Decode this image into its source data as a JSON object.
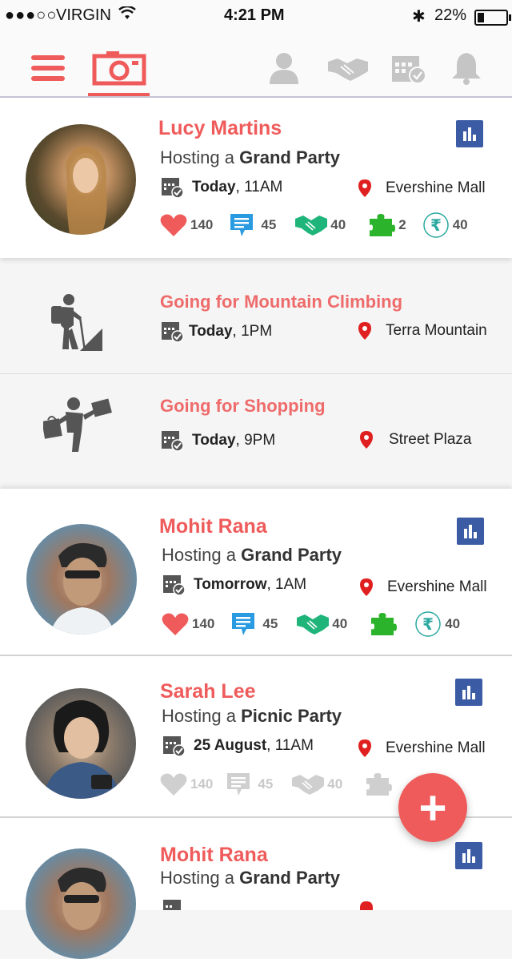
{
  "status_bar": {
    "carrier": "VIRGIN",
    "time": "4:21 PM",
    "battery": "22%"
  },
  "navbar": {
    "items": [
      {
        "name": "menu-icon"
      },
      {
        "name": "camera-icon",
        "active": true
      },
      {
        "name": "profile-icon"
      },
      {
        "name": "handshake-icon"
      },
      {
        "name": "calendar-icon"
      },
      {
        "name": "bell-icon"
      }
    ],
    "accent": "#ef5b5b"
  },
  "feed": [
    {
      "type": "host",
      "name": "Lucy Martins",
      "hosting_prefix": "Hosting a",
      "event": "Grand Party",
      "day": "Today",
      "time": ", 11AM",
      "location": "Evershine Mall",
      "stats": {
        "likes": "140",
        "comments": "45",
        "handshakes": "40",
        "puzzles": "2",
        "rupees": "40"
      }
    },
    {
      "type": "activity",
      "title": "Going for Mountain Climbing",
      "day": "Today",
      "time": ", 1PM",
      "location": "Terra Mountain"
    },
    {
      "type": "activity",
      "title": "Going for Shopping",
      "day": "Today",
      "time": ", 9PM",
      "location": "Street Plaza"
    },
    {
      "type": "host",
      "name": "Mohit Rana",
      "hosting_prefix": "Hosting a",
      "event": "Grand Party",
      "day": "Tomorrow",
      "time": ", 1AM",
      "location": "Evershine Mall",
      "stats": {
        "likes": "140",
        "comments": "45",
        "handshakes": "40",
        "rupees": "40"
      }
    },
    {
      "type": "host",
      "name": "Sarah Lee",
      "hosting_prefix": "Hosting a",
      "event": "Picnic Party",
      "day": "25 August",
      "time": ", 11AM",
      "location": "Evershine Mall",
      "stats": {
        "likes": "140",
        "comments": "45",
        "handshakes": "40"
      }
    },
    {
      "type": "host",
      "name": "Mohit Rana",
      "hosting_prefix": "Hosting a",
      "event": "Grand Party"
    }
  ],
  "fab": {
    "label": "+"
  },
  "colors": {
    "name": "#ef5b5b",
    "heart": "#ef5b5b",
    "comment": "#2a9be0",
    "handshake": "#1fb57a",
    "puzzle": "#2bb32b",
    "rupee": "#2aa9a0",
    "stats_button": "#3b5ba5",
    "pin": "#e02020"
  }
}
